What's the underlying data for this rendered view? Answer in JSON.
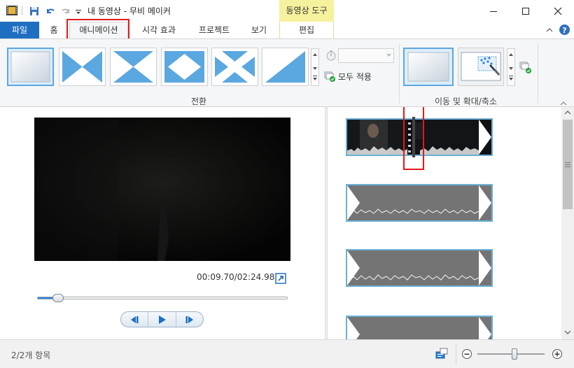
{
  "window": {
    "title": "내 동영상 - 무비 메이커",
    "context_tab_group": "동영상 도구"
  },
  "ribbon_tabs": [
    {
      "label": "파일"
    },
    {
      "label": "홈"
    },
    {
      "label": "애니메이션"
    },
    {
      "label": "시각 효과"
    },
    {
      "label": "프로젝트"
    },
    {
      "label": "보기"
    },
    {
      "label": "편집"
    }
  ],
  "transitions_group": {
    "label": "전환",
    "duration_value": "",
    "apply_all_label": "모두 적용",
    "items": [
      {
        "icon": "no-transition-icon"
      },
      {
        "icon": "bowtie-vertical-transition-icon"
      },
      {
        "icon": "bowtie-horizontal-transition-icon"
      },
      {
        "icon": "diamond-transition-icon"
      },
      {
        "icon": "cross-transition-icon"
      },
      {
        "icon": "diagonal-wipe-transition-icon"
      }
    ]
  },
  "pan_zoom_group": {
    "label": "이동 및 확대/축소",
    "items": [
      {
        "icon": "no-pan-zoom-icon"
      },
      {
        "icon": "auto-pan-zoom-icon"
      }
    ]
  },
  "player": {
    "time": "00:09.70/02:24.98",
    "progress": 0.067
  },
  "status": {
    "items": "2/2개 항목",
    "zoom_level": 0.55
  },
  "colors": {
    "file_tab": "#1e6fc2",
    "context_tab": "#f6f19c",
    "highlight": "#e21a1a",
    "clip_border": "#6ab0d6"
  }
}
